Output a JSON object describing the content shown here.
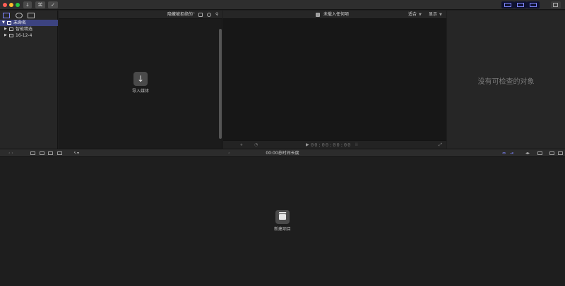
{
  "window": {
    "traffic_colors": [
      "#ff5f57",
      "#febc2e",
      "#28c840"
    ],
    "key_button_label": "⌘"
  },
  "sidebar": {
    "items": [
      {
        "label": "未命名",
        "selected": true
      },
      {
        "label": "智能精选",
        "selected": false
      },
      {
        "label": "16-12-4",
        "selected": false
      }
    ]
  },
  "browser": {
    "filter_label": "隐藏被拒绝的",
    "import_label": "导入媒体"
  },
  "viewer": {
    "title": "未载入任何项",
    "fit_label": "适合",
    "display_label": "显示",
    "timecode": "00:00:00:00"
  },
  "inspector": {
    "empty_message": "没有可检查的对象"
  },
  "timeline": {
    "duration_label": "00:00总时间长度",
    "new_project_label": "新建项目"
  },
  "colors": {
    "accent": "#7f86ff",
    "selection": "#3c4380"
  }
}
